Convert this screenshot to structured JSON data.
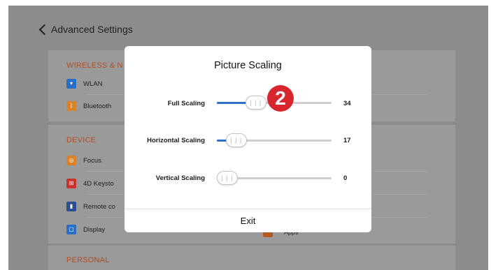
{
  "header": {
    "back_label": "Advanced Settings"
  },
  "sections": [
    {
      "title": "WIRELESS & N",
      "items": [
        {
          "label": "WLAN",
          "icon": "wifi-icon",
          "color": "#2b6fc4"
        },
        {
          "label": "Bluetooth",
          "icon": "bluetooth-icon",
          "color": "#d9822b"
        }
      ]
    },
    {
      "title": "DEVICE",
      "items": [
        {
          "label": "Focus",
          "icon": "focus-icon",
          "color": "#d9822b"
        },
        {
          "label": "4D Keysto",
          "icon": "keystone-icon",
          "color": "#c9332b"
        },
        {
          "label": "Remote co",
          "icon": "remote-icon",
          "color": "#2b4f8f"
        },
        {
          "label": "Display",
          "icon": "display-icon",
          "color": "#2b6fc4"
        }
      ]
    },
    {
      "title": "PERSONAL",
      "items": []
    }
  ],
  "right_column": {
    "apps_label": "Apps"
  },
  "dialog": {
    "title": "Picture Scaling",
    "sliders": [
      {
        "label": "Full Scaling",
        "value": "34",
        "fraction": 0.34
      },
      {
        "label": "Horizontal Scaling",
        "value": "17",
        "fraction": 0.17
      },
      {
        "label": "Vertical Scaling",
        "value": "0",
        "fraction": 0.0
      }
    ],
    "exit_label": "Exit",
    "callout_number": "2",
    "accent_color": "#2f6fc4",
    "callout_color": "#d7262e"
  }
}
